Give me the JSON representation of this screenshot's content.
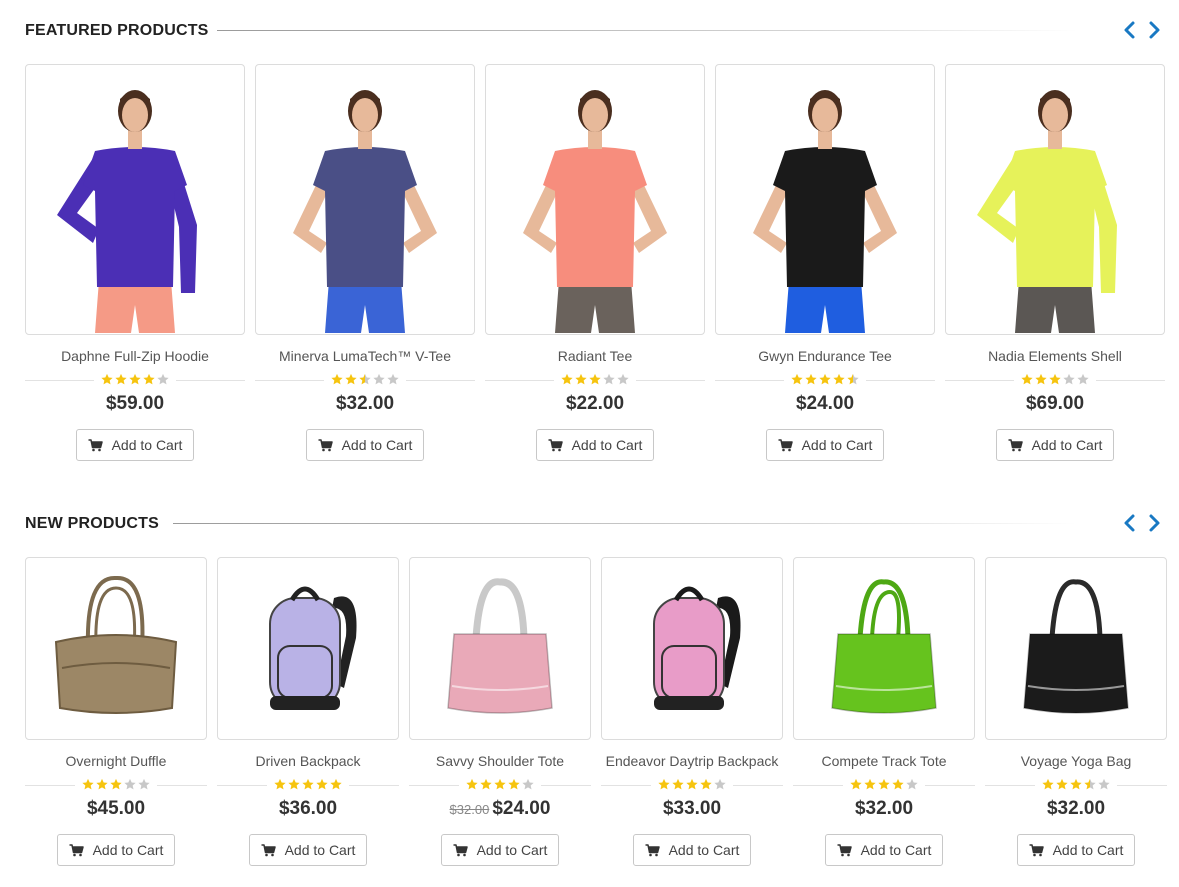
{
  "sections": {
    "featured": {
      "title": "FEATURED PRODUCTS",
      "products": [
        {
          "name": "Daphne Full-Zip Hoodie",
          "rating": 4,
          "price": "$59.00",
          "old_price": "",
          "cart_label": "Add to Cart",
          "image": "model-hoodie",
          "top_color": "#4b2fb5",
          "bottom_color": "#f59a86"
        },
        {
          "name": "Minerva LumaTech™ V-Tee",
          "rating": 2.5,
          "price": "$32.00",
          "old_price": "",
          "cart_label": "Add to Cart",
          "image": "model-vtee",
          "top_color": "#4a4f86",
          "bottom_color": "#3a64d6"
        },
        {
          "name": "Radiant Tee",
          "rating": 3,
          "price": "$22.00",
          "old_price": "",
          "cart_label": "Add to Cart",
          "image": "model-tee",
          "top_color": "#f78d7d",
          "bottom_color": "#6a625c"
        },
        {
          "name": "Gwyn Endurance Tee",
          "rating": 4.5,
          "price": "$24.00",
          "old_price": "",
          "cart_label": "Add to Cart",
          "image": "model-tee-black",
          "top_color": "#1a1a1a",
          "bottom_color": "#1f5ee0"
        },
        {
          "name": "Nadia Elements Shell",
          "rating": 3,
          "price": "$69.00",
          "old_price": "",
          "cart_label": "Add to Cart",
          "image": "model-jacket",
          "top_color": "#e6f25a",
          "bottom_color": "#5b5754"
        }
      ]
    },
    "new": {
      "title": "NEW PRODUCTS",
      "products": [
        {
          "name": "Overnight Duffle",
          "rating": 3,
          "price": "$45.00",
          "old_price": "",
          "cart_label": "Add to Cart",
          "image": "duffle-bag",
          "bag_color": "#9c8766",
          "strap_color": "#7c6a4e"
        },
        {
          "name": "Driven Backpack",
          "rating": 5,
          "price": "$36.00",
          "old_price": "",
          "cart_label": "Add to Cart",
          "image": "backpack-lavender",
          "bag_color": "#b9b2e6",
          "strap_color": "#222222"
        },
        {
          "name": "Savvy Shoulder Tote",
          "rating": 4,
          "price": "$24.00",
          "old_price": "$32.00",
          "cart_label": "Add to Cart",
          "image": "tote-pink",
          "bag_color": "#e9a9b8",
          "strap_color": "#c9c9c9"
        },
        {
          "name": "Endeavor Daytrip Backpack",
          "rating": 4,
          "price": "$33.00",
          "old_price": "",
          "cart_label": "Add to Cart",
          "image": "backpack-pink",
          "bag_color": "#e89cc8",
          "strap_color": "#1a1a1a"
        },
        {
          "name": "Compete Track Tote",
          "rating": 4,
          "price": "$32.00",
          "old_price": "",
          "cart_label": "Add to Cart",
          "image": "tote-green",
          "bag_color": "#66c31e",
          "strap_color": "#4ea814"
        },
        {
          "name": "Voyage Yoga Bag",
          "rating": 3.5,
          "price": "$32.00",
          "old_price": "",
          "cart_label": "Add to Cart",
          "image": "tote-black",
          "bag_color": "#1b1b1b",
          "strap_color": "#2a2a2a"
        }
      ]
    }
  },
  "icons": {
    "prev": "chevron-left-icon",
    "next": "chevron-right-icon",
    "cart": "cart-icon",
    "star": "star-icon"
  },
  "colors": {
    "accent": "#1979c3",
    "star_on": "#f6c40f",
    "star_off": "#c8c8c8"
  }
}
